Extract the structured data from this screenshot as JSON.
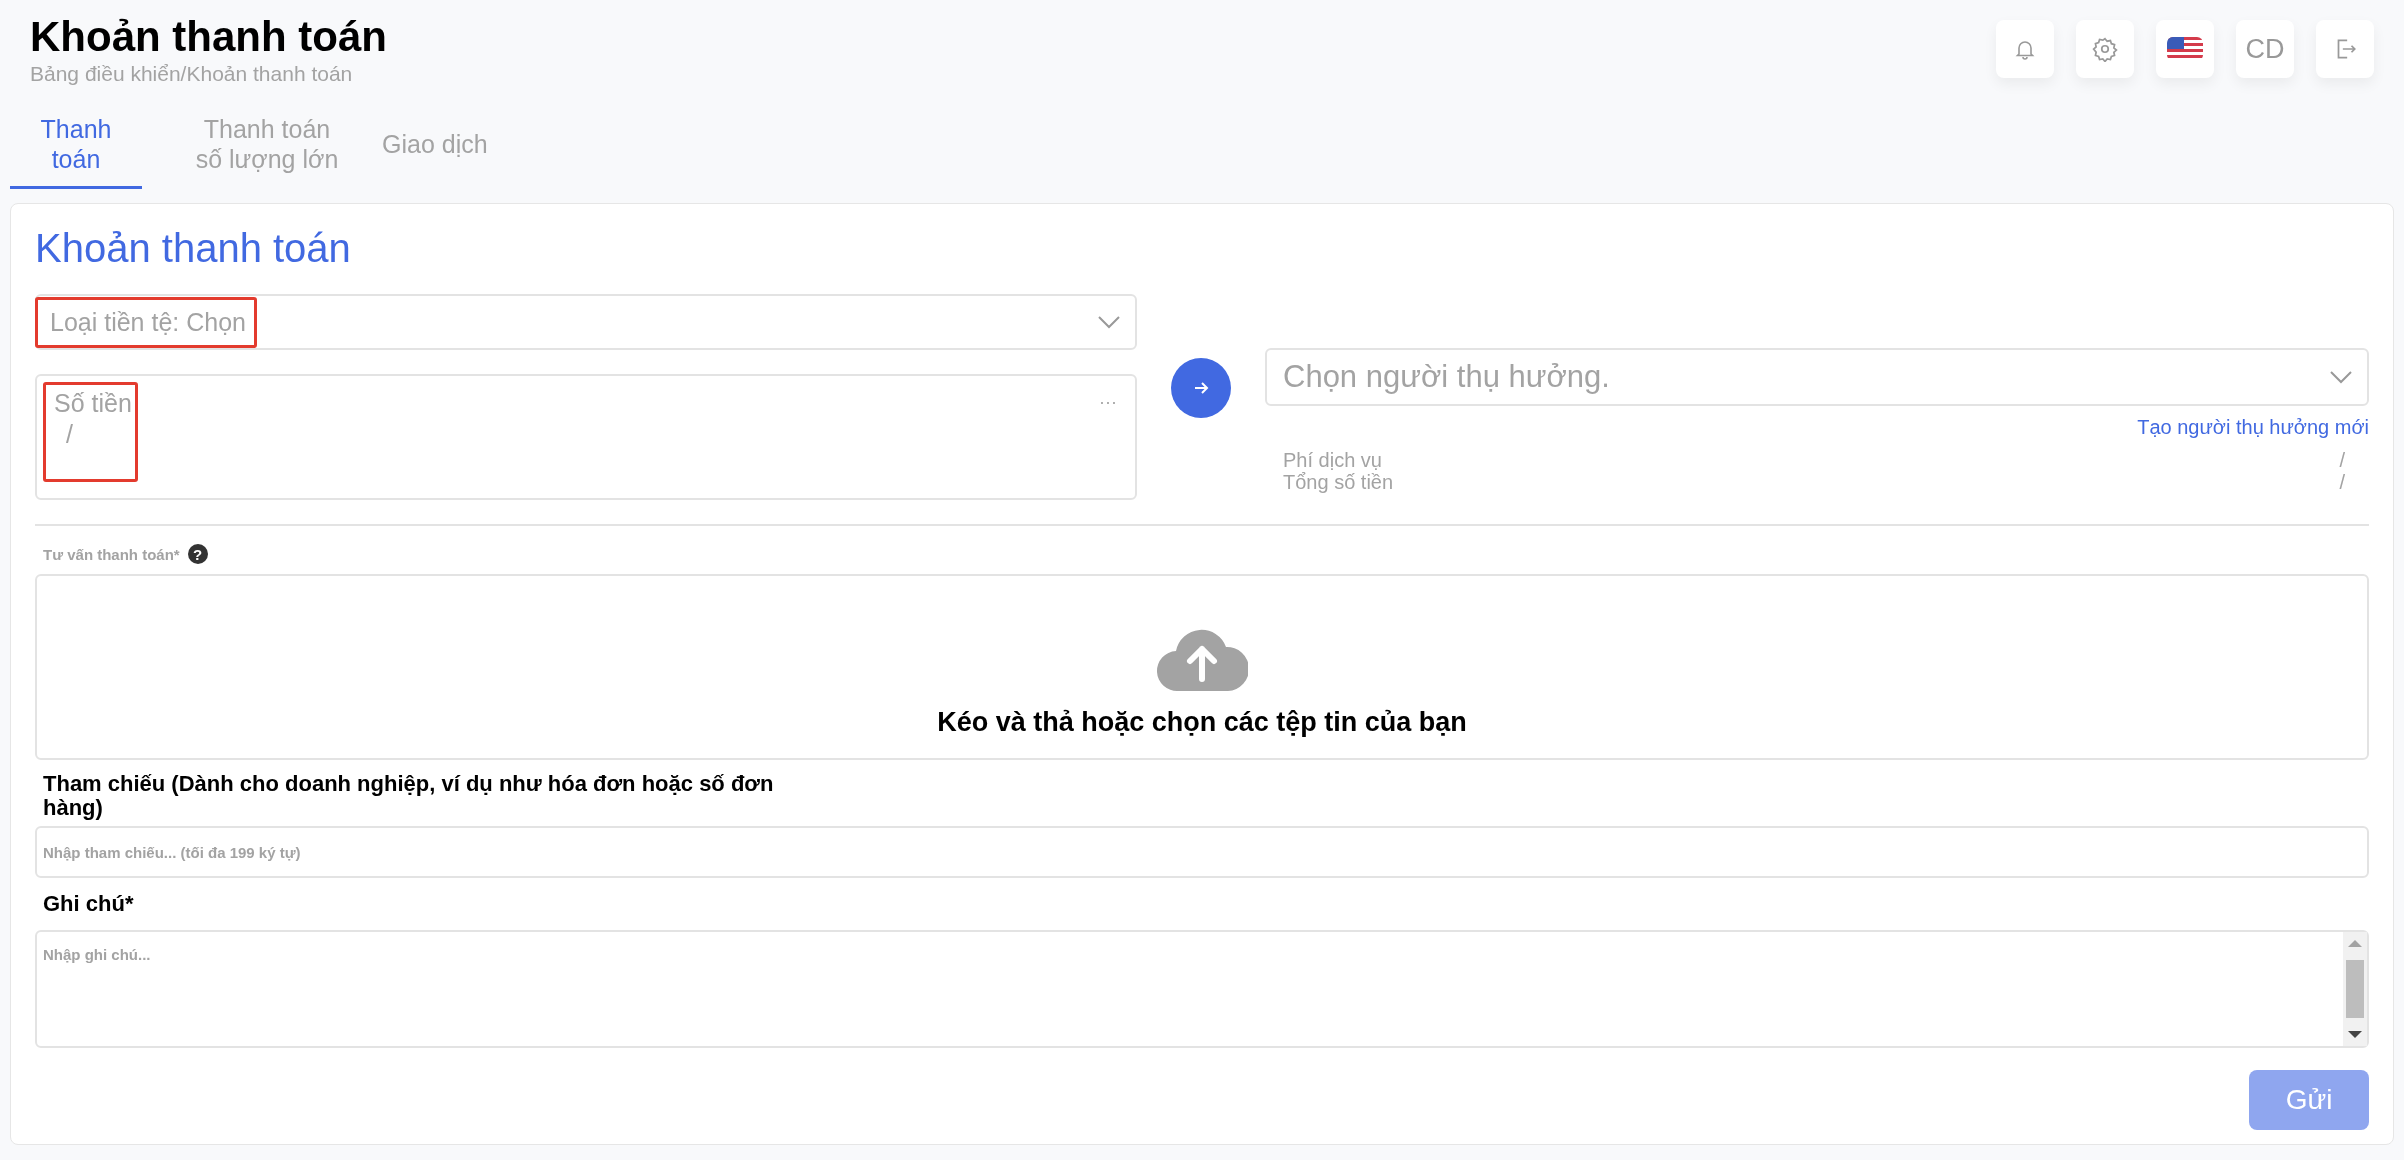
{
  "header": {
    "title": "Khoản thanh toán",
    "breadcrumb": "Bảng điều khiển/Khoản thanh toán",
    "avatar_initials": "CD"
  },
  "tabs": [
    {
      "label": "Thanh toán",
      "selected": true
    },
    {
      "label": "Thanh toán số lượng lớn",
      "selected": false
    },
    {
      "label": "Giao dịch",
      "selected": false
    }
  ],
  "card": {
    "title": "Khoản thanh toán",
    "currency_select": {
      "value": "Loại tiền tệ: Chọn",
      "highlighted": true
    },
    "amount_field": {
      "label": "Số tiền",
      "value": "/",
      "more": "···",
      "highlighted": true
    },
    "beneficiary_select": {
      "placeholder": "Chọn người thụ hưởng."
    },
    "new_beneficiary_link": "Tạo người thụ hưởng mới",
    "summary": [
      {
        "label": "Phí dịch vụ",
        "value": "/"
      },
      {
        "label": "Tổng số tiền",
        "value": "/"
      }
    ],
    "upload": {
      "label": "Tư vấn thanh toán*",
      "help": "?",
      "prompt": "Kéo và thả hoặc chọn các tệp tin của bạn"
    },
    "reference": {
      "label": "Tham chiếu (Dành cho doanh nghiệp, ví dụ như hóa đơn hoặc số đơn hàng)",
      "placeholder": "Nhập tham chiếu... (tối đa 199 ký tự)"
    },
    "note": {
      "label": "Ghi chú*",
      "placeholder": "Nhập ghi chú..."
    },
    "submit": {
      "label": "Gửi",
      "disabled": true
    }
  }
}
